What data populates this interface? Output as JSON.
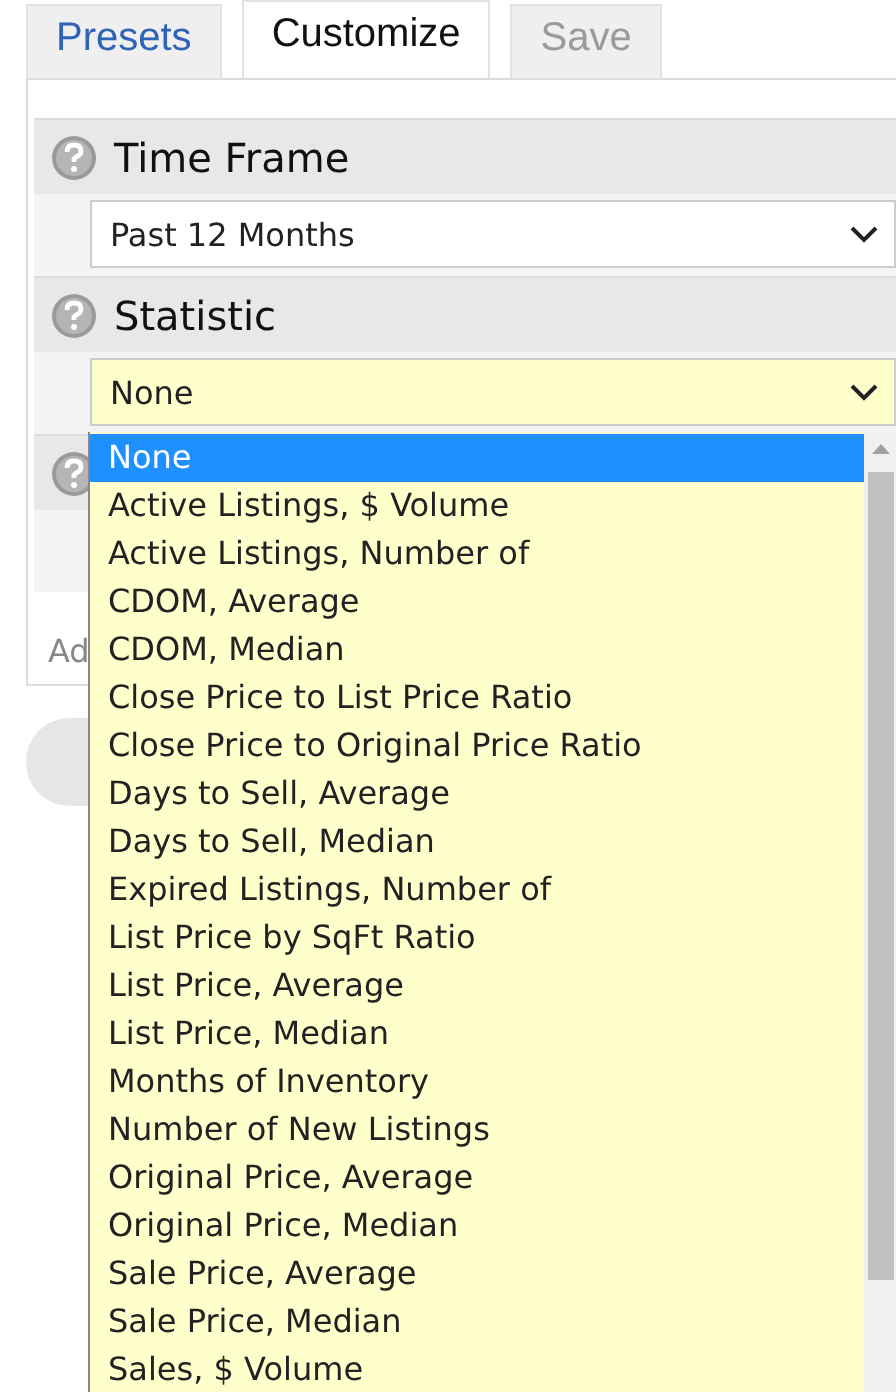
{
  "tabs": [
    {
      "label": "Presets",
      "selected": false,
      "disabled": false
    },
    {
      "label": "Customize",
      "selected": true,
      "disabled": false
    },
    {
      "label": "Save",
      "selected": false,
      "disabled": true
    }
  ],
  "sections": [
    {
      "title": "Time Frame",
      "value": "Past 12 Months",
      "focused": false
    },
    {
      "title": "Statistic",
      "value": "None",
      "focused": true
    }
  ],
  "add_link": "Ad",
  "dropdown": {
    "options": [
      {
        "label": "None",
        "selected": true
      },
      {
        "label": "Active Listings, $ Volume",
        "selected": false
      },
      {
        "label": "Active Listings, Number of",
        "selected": false
      },
      {
        "label": "CDOM, Average",
        "selected": false
      },
      {
        "label": "CDOM, Median",
        "selected": false
      },
      {
        "label": "Close Price to List Price Ratio",
        "selected": false
      },
      {
        "label": "Close Price to Original Price Ratio",
        "selected": false
      },
      {
        "label": "Days to Sell, Average",
        "selected": false
      },
      {
        "label": "Days to Sell, Median",
        "selected": false
      },
      {
        "label": "Expired Listings, Number of",
        "selected": false
      },
      {
        "label": "List Price by SqFt Ratio",
        "selected": false
      },
      {
        "label": "List Price, Average",
        "selected": false
      },
      {
        "label": "List Price, Median",
        "selected": false
      },
      {
        "label": "Months of Inventory",
        "selected": false
      },
      {
        "label": "Number of New Listings",
        "selected": false
      },
      {
        "label": "Original Price, Average",
        "selected": false
      },
      {
        "label": "Original Price, Median",
        "selected": false
      },
      {
        "label": "Sale Price, Average",
        "selected": false
      },
      {
        "label": "Sale Price, Median",
        "selected": false
      },
      {
        "label": "Sales, $ Volume",
        "selected": false
      }
    ]
  }
}
